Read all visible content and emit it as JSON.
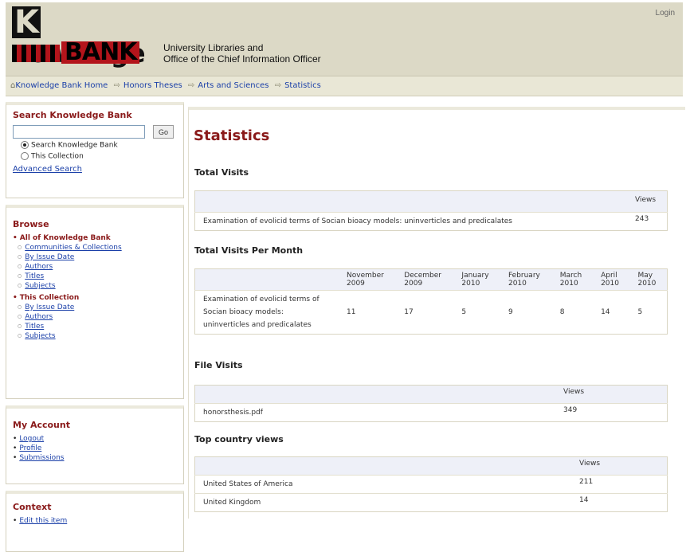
{
  "header": {
    "logo_top": "nowledge",
    "logo_k": "K",
    "logo_bank": "BANK",
    "org_line1": "University Libraries and",
    "org_line2": "Office of the Chief Information Officer",
    "login": "Login"
  },
  "breadcrumb": [
    "Knowledge Bank Home",
    "Honors Theses",
    "Arts and Sciences",
    "Statistics"
  ],
  "sidebar": {
    "search": {
      "title": "Search Knowledge Bank",
      "placeholder": "",
      "go_label": "Go",
      "option1": "Search Knowledge Bank",
      "option2": "This Collection",
      "advanced": "Advanced Search"
    },
    "browse": {
      "title": "Browse",
      "all_label": "All of Knowledge Bank",
      "all_items": [
        "Communities & Collections",
        "By Issue Date",
        "Authors",
        "Titles",
        "Subjects"
      ],
      "collection_label": "This Collection",
      "collection_items": [
        "By Issue Date",
        "Authors",
        "Titles",
        "Subjects"
      ]
    },
    "account": {
      "title": "My Account",
      "items": [
        "Logout",
        "Profile",
        "Submissions"
      ]
    },
    "context": {
      "title": "Context",
      "items": [
        "Edit this item"
      ]
    }
  },
  "main": {
    "title": "Statistics",
    "total_visits": {
      "heading": "Total Visits",
      "views_header": "Views",
      "item": "Examination of evolicid terms of Socian bioacy models: uninverticles and predicalates",
      "views": "243"
    },
    "per_month": {
      "heading": "Total Visits Per Month",
      "months": [
        {
          "m": "November",
          "y": "2009"
        },
        {
          "m": "December",
          "y": "2009"
        },
        {
          "m": "January",
          "y": "2010"
        },
        {
          "m": "February",
          "y": "2010"
        },
        {
          "m": "March",
          "y": "2010"
        },
        {
          "m": "April",
          "y": "2010"
        },
        {
          "m": "May",
          "y": "2010"
        }
      ],
      "item_line1": "Examination of evolicid terms of",
      "item_line2": "Socian bioacy models:",
      "item_line3": "uninverticles and predicalates",
      "values": [
        "11",
        "17",
        "5",
        "9",
        "8",
        "14",
        "5"
      ]
    },
    "file_visits": {
      "heading": "File Visits",
      "views_header": "Views",
      "file": "honorsthesis.pdf",
      "views": "349"
    },
    "country": {
      "heading": "Top country views",
      "views_header": "Views",
      "rows": [
        {
          "country": "United States of America",
          "views": "211"
        },
        {
          "country": "United Kingdom",
          "views": "14"
        }
      ]
    }
  }
}
